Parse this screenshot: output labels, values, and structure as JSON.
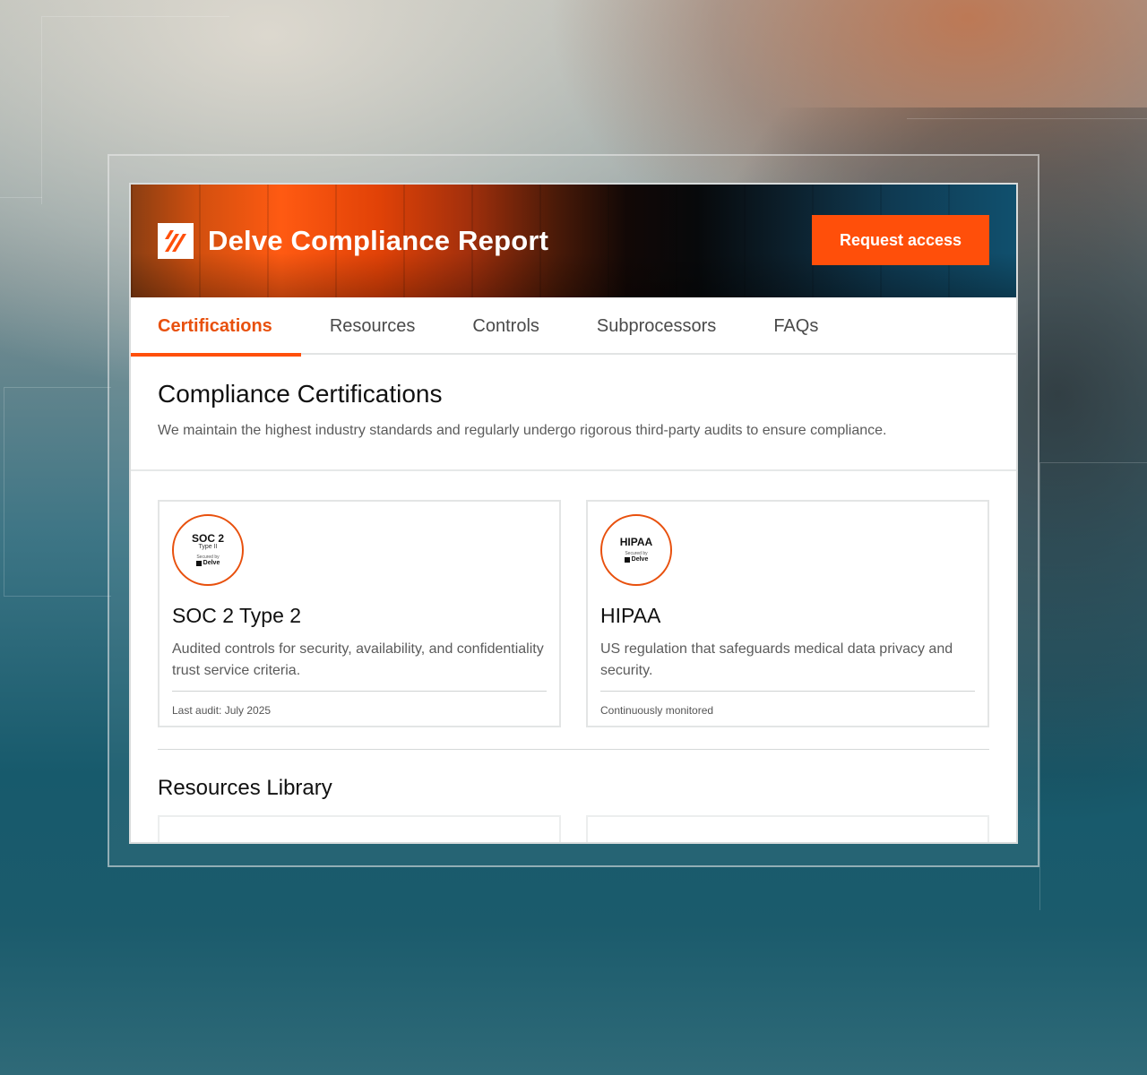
{
  "header": {
    "brand_title": "Delve Compliance Report",
    "request_label": "Request access"
  },
  "tabs": [
    {
      "label": "Certifications",
      "active": true
    },
    {
      "label": "Resources",
      "active": false
    },
    {
      "label": "Controls",
      "active": false
    },
    {
      "label": "Subprocessors",
      "active": false
    },
    {
      "label": "FAQs",
      "active": false
    }
  ],
  "section": {
    "title": "Compliance Certifications",
    "description": "We maintain the highest industry standards and regularly undergo rigorous third-party audits to ensure compliance."
  },
  "cards": [
    {
      "badge_main": "SOC 2",
      "badge_sub": "Type II",
      "badge_secured": "Secured by",
      "badge_brand": "Delve",
      "title": "SOC 2 Type 2",
      "description": "Audited controls for security, availability, and confidentiality trust service criteria.",
      "meta": "Last audit: July 2025"
    },
    {
      "badge_main": "HIPAA",
      "badge_secured": "Secured by",
      "badge_brand": "Delve",
      "title": "HIPAA",
      "description": "US regulation that safeguards medical data privacy and security.",
      "meta": "Continuously monitored"
    }
  ],
  "resources": {
    "title": "Resources Library"
  },
  "colors": {
    "accent": "#ff4f0a",
    "accent_text": "#e8500d"
  },
  "icons": {
    "logo": "delve-logo-icon"
  }
}
